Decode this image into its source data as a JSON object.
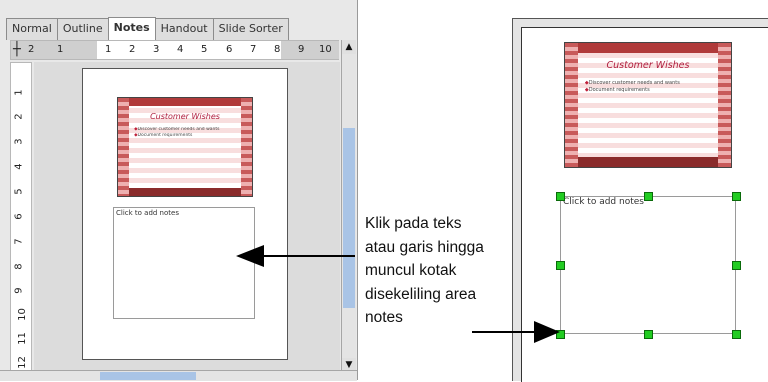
{
  "tabs": [
    {
      "label": "Normal",
      "active": false
    },
    {
      "label": "Outline",
      "active": false
    },
    {
      "label": "Notes",
      "active": true
    },
    {
      "label": "Handout",
      "active": false
    },
    {
      "label": "Slide Sorter",
      "active": false
    }
  ],
  "hruler_numbers": [
    "2",
    "1",
    "1",
    "2",
    "3",
    "4",
    "5",
    "6",
    "7",
    "8",
    "9",
    "10"
  ],
  "vruler_numbers": [
    "1",
    "2",
    "3",
    "4",
    "5",
    "6",
    "7",
    "8",
    "9",
    "10",
    "11",
    "12"
  ],
  "slide": {
    "title": "Customer Wishes",
    "bullets": [
      "Discover customer needs and wants",
      "Document requirements"
    ]
  },
  "notes_placeholder": "Click to add notes",
  "callout_text": [
    "Klik pada teks",
    "atau garis hingga",
    "muncul kotak",
    "disekeliling area",
    "notes"
  ],
  "colors": {
    "selection_handle": "#22cc22",
    "scroll_thumb": "#a9c4e6",
    "slide_title": "#b02040"
  }
}
